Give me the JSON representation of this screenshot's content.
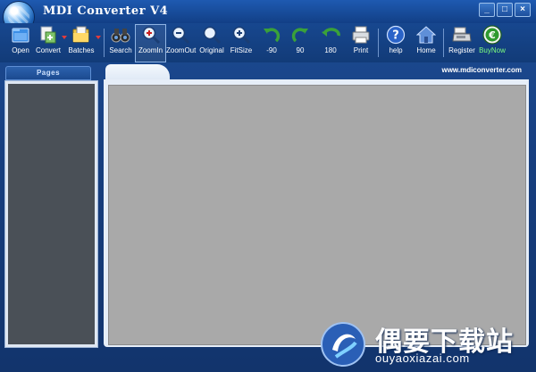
{
  "window": {
    "title": "MDI Converter V4",
    "controls": [
      "_",
      "□",
      "×"
    ]
  },
  "toolbar": {
    "buttons": [
      {
        "id": "open",
        "label": "Open",
        "icon": "folder-open-icon"
      },
      {
        "id": "convert",
        "label": "Convert",
        "icon": "convert-icon"
      },
      {
        "id": "batches",
        "label": "Batches",
        "icon": "batch-folder-icon"
      },
      {
        "id": "search",
        "label": "Search",
        "icon": "binoculars-icon"
      },
      {
        "id": "zoomin",
        "label": "ZoomIn",
        "icon": "zoom-in-icon",
        "active": true
      },
      {
        "id": "zoomout",
        "label": "ZoomOut",
        "icon": "zoom-out-icon"
      },
      {
        "id": "original",
        "label": "Original",
        "icon": "magnifier-icon"
      },
      {
        "id": "fitsize",
        "label": "FitSize",
        "icon": "fit-size-icon"
      },
      {
        "id": "rot-90",
        "label": "-90",
        "icon": "rotate-left-icon"
      },
      {
        "id": "rot90",
        "label": "90",
        "icon": "rotate-right-icon"
      },
      {
        "id": "rot180",
        "label": "180",
        "icon": "rotate-180-icon"
      },
      {
        "id": "print",
        "label": "Print",
        "icon": "printer-icon"
      },
      {
        "id": "help",
        "label": "help",
        "icon": "help-icon"
      },
      {
        "id": "home",
        "label": "Home",
        "icon": "home-icon"
      },
      {
        "id": "register",
        "label": "Register",
        "icon": "cash-register-icon"
      },
      {
        "id": "buynow",
        "label": "BuyNow",
        "icon": "euro-coin-icon"
      }
    ]
  },
  "tabs": {
    "pages_label": "Pages"
  },
  "site_url": "www.mdiconverter.com",
  "watermark": {
    "title": "偶要下载站",
    "subtitle": "ouyaoxiazai.com"
  },
  "colors": {
    "frame": "#1a4a8f",
    "canvas": "#a9a9a9",
    "left_panel": "#4a5057",
    "buy_label": "#7dff7d"
  }
}
